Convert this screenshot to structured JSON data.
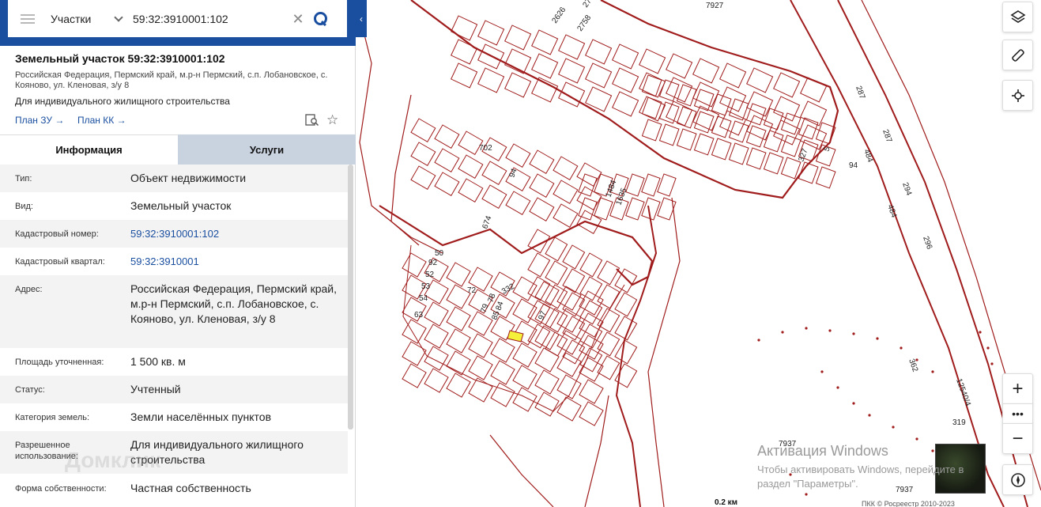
{
  "search": {
    "layer": "Участки",
    "query": "59:32:3910001:102"
  },
  "parcel": {
    "title": "Земельный участок 59:32:3910001:102",
    "address": "Российская Федерация, Пермский край, м.р-н Пермский, с.п. Лобановское, с. Кояново, ул. Кленовая, з/у 8",
    "use": "Для индивидуального жилищного строительства",
    "plan_zu": "План ЗУ →",
    "plan_kk": "План КК →"
  },
  "tabs": {
    "info": "Информация",
    "services": "Услуги"
  },
  "props": [
    {
      "label": "Тип:",
      "value": "Объект недвижимости"
    },
    {
      "label": "Вид:",
      "value": "Земельный участок"
    },
    {
      "label": "Кадастровый номер:",
      "value": "59:32:3910001:102"
    },
    {
      "label": "Кадастровый квартал:",
      "value": "59:32:3910001"
    },
    {
      "label": "Адрес:",
      "value": "Российская Федерация, Пермский край, м.р-н Пермский, с.п. Лобановское, с. Кояново, ул. Кленовая, з/у 8"
    },
    {
      "label": "Площадь уточненная:",
      "value": "1 500 кв. м"
    },
    {
      "label": "Статус:",
      "value": "Учтенный"
    },
    {
      "label": "Категория земель:",
      "value": "Земли населённых пунктов"
    },
    {
      "label": "Разрешенное использование:",
      "value": "Для индивидуального жилищного строительства"
    },
    {
      "label": "Форма собственности:",
      "value": "Частная собственность"
    }
  ],
  "watermark": "Домклик",
  "map": {
    "labels": {
      "l7927a": "7927",
      "l7927b": "7937",
      "l7937": "7937",
      "l319": "319"
    },
    "numbers": [
      "2759",
      "2626",
      "2758",
      "702",
      "94",
      "674",
      "1484",
      "1635",
      "327",
      "5",
      "94",
      "50",
      "92",
      "52",
      "53",
      "54",
      "63",
      "72",
      "332",
      "78",
      "84",
      "79",
      "85",
      "97",
      "484",
      "287",
      "294",
      "296",
      "362",
      "12540/4",
      "484",
      "287"
    ],
    "highlight_color": "#f5f03a",
    "line_color": "#a01c1c"
  },
  "controls": {
    "zoom_in": "+",
    "zoom_more": "•••",
    "zoom_out": "−"
  },
  "windows": {
    "activate": "Активация Windows",
    "sub": "Чтобы активировать Windows, перейдите в раздел \"Параметры\"."
  },
  "scale": "0.2 км",
  "copyright": "ПКК © Росреестр 2010-2023"
}
